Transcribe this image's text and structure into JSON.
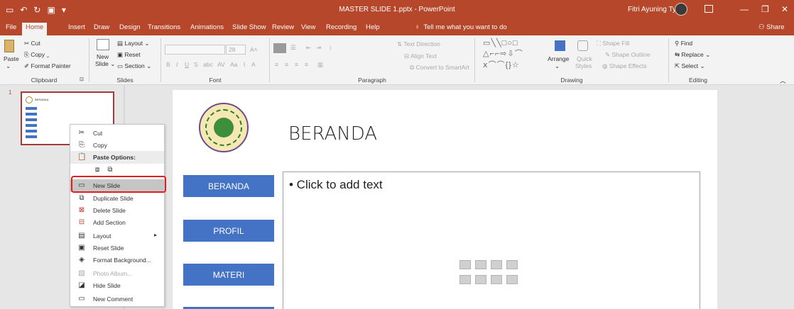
{
  "window": {
    "title": "MASTER SLIDE 1.pptx  -  PowerPoint",
    "user_name": "Fitri Ayuning Tyas",
    "quick_access": [
      "save-icon",
      "undo-icon",
      "redo-icon",
      "present-icon",
      "customize-icon"
    ],
    "controls": [
      "minimize",
      "restore",
      "close"
    ]
  },
  "tabs": {
    "items": [
      "File",
      "Home",
      "Insert",
      "Draw",
      "Design",
      "Transitions",
      "Animations",
      "Slide Show",
      "Review",
      "View",
      "Recording",
      "Help"
    ],
    "active": "Home",
    "tell_me": "Tell me what you want to do",
    "share": "Share"
  },
  "ribbon": {
    "clipboard": {
      "paste": "Paste",
      "cut": "Cut",
      "copy": "Copy",
      "format_painter": "Format Painter",
      "label": "Clipboard"
    },
    "slides": {
      "new_slide_line1": "New",
      "new_slide_line2": "Slide",
      "layout": "Layout",
      "reset": "Reset",
      "section": "Section",
      "label": "Slides"
    },
    "font": {
      "size": "28",
      "label": "Font",
      "aa": "Aa"
    },
    "paragraph": {
      "text_direction": "Text Direction",
      "align_text": "Align Text",
      "convert_smartart": "Convert to SmartArt",
      "label": "Paragraph"
    },
    "drawing": {
      "arrange": "Arrange",
      "quick_styles_1": "Quick",
      "quick_styles_2": "Styles",
      "shape_fill": "Shape Fill",
      "shape_outline": "Shape Outline",
      "shape_effects": "Shape Effects",
      "label": "Drawing"
    },
    "editing": {
      "find": "Find",
      "replace": "Replace",
      "select": "Select",
      "label": "Editing"
    }
  },
  "thumbnail": {
    "number": "1",
    "title": "BERANDA"
  },
  "slide": {
    "title": "BERANDA",
    "buttons": [
      "BERANDA",
      "PROFIL",
      "MATERI"
    ],
    "placeholder": "• Click to add text"
  },
  "context_menu": {
    "items": [
      {
        "label": "Cut",
        "icon": "scissors-icon"
      },
      {
        "label": "Copy",
        "icon": "copy-icon"
      },
      {
        "label": "Paste Options:",
        "icon": "paste-icon",
        "header": true
      },
      {
        "label": "New Slide",
        "icon": "new-slide-icon",
        "highlighted": true
      },
      {
        "label": "Duplicate Slide",
        "icon": "duplicate-slide-icon"
      },
      {
        "label": "Delete Slide",
        "icon": "delete-slide-icon"
      },
      {
        "label": "Add Section",
        "icon": "add-section-icon"
      },
      {
        "label": "Layout",
        "icon": "layout-icon",
        "submenu": true
      },
      {
        "label": "Reset Slide",
        "icon": "reset-slide-icon"
      },
      {
        "label": "Format Background...",
        "icon": "format-background-icon"
      },
      {
        "label": "Photo Album...",
        "icon": "photo-album-icon",
        "disabled": true
      },
      {
        "label": "Hide Slide",
        "icon": "hide-slide-icon"
      },
      {
        "label": "New Comment",
        "icon": "comment-icon"
      }
    ]
  },
  "colors": {
    "accent": "#b7472a",
    "slide_button": "#4472c4",
    "highlight_box": "#e01e1e"
  }
}
